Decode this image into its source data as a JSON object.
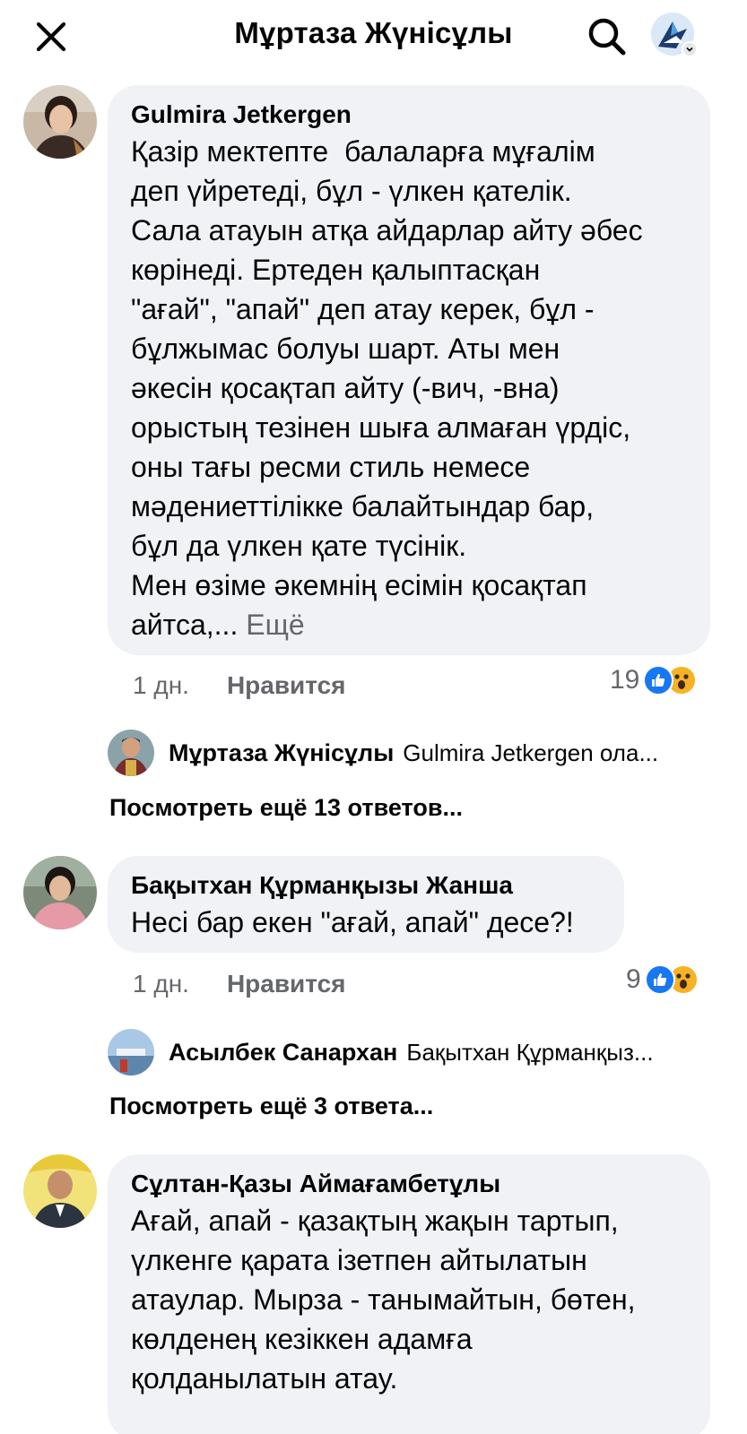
{
  "header": {
    "title": "Мұртаза Жүнісұлы",
    "close_icon": "close-icon",
    "search_icon": "search-icon"
  },
  "comments": [
    {
      "author": "Gulmira Jetkergen",
      "text": "Қазір мектепте  балаларға мұғалім\nдеп үйретеді, бұл - үлкен қателік.\nСала атауын атқа айдарлар айту әбес\nкөрінеді. Ертеден қалыптасқан\n\"ағай\", \"апай\" деп атау керек, бұл -\nбұлжымас болуы шарт. Аты мен\nәкесін қосақтап айту (-вич, -вна)\nорыстың тезінен шыға алмаған үрдіс,\nоны тағы ресми стиль немесе\nмәдениеттілікке балайтындар бар,\nбұл да үлкен қате түсінік.\nМен өзіме әкемнің есімін қосақтап\nайтса,... ",
      "more": "Ещё",
      "time": "1 дн.",
      "like_label": "Нравится",
      "reaction_count": "19",
      "reply_author": "Мұртаза Жүнісұлы",
      "reply_text": "Gulmira Jetkergen ола...",
      "view_more": "Посмотреть ещё 13 ответов..."
    },
    {
      "author": "Бақытхан Құрманқызы Жанша",
      "text": "Несі бар екен \"ағай, апай\" десе?!",
      "time": "1 дн.",
      "like_label": "Нравится",
      "reaction_count": "9",
      "reply_author": "Асылбек Санархан",
      "reply_text": "Бақытхан Құрманқыз...",
      "view_more": "Посмотреть ещё 3 ответа..."
    },
    {
      "author": "Сұлтан-Қазы Аймағамбетұлы",
      "text": "Ағай, апай - қазақтың жақын тартып,\nүлкенге қарата ізетпен айтылатын\nатаулар. Мырза - танымайтын, бөтен,\nкөлденең кезіккен адамға\nқолданылатын атау."
    }
  ],
  "colors": {
    "bubble": "#f0f2f5",
    "secondary_text": "#65676b",
    "like_blue": "#1877f2",
    "wow_yellow": "#f7b125"
  }
}
